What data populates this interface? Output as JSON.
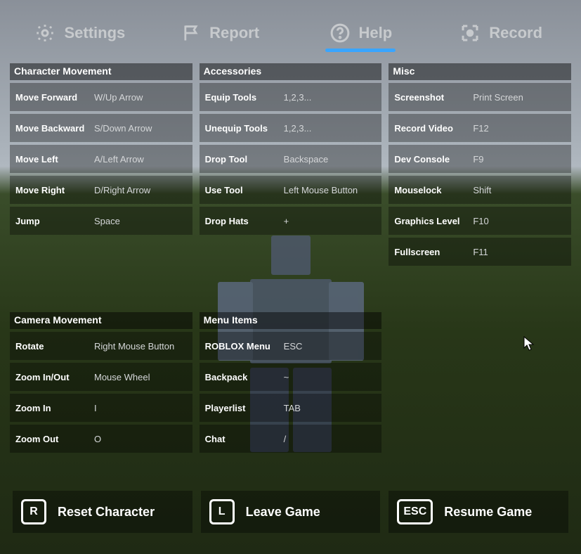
{
  "tabs": {
    "settings": "Settings",
    "report": "Report",
    "help": "Help",
    "record": "Record"
  },
  "sections": {
    "characterMovement": {
      "title": "Character Movement",
      "rows": [
        {
          "label": "Move Forward",
          "value": "W/Up Arrow"
        },
        {
          "label": "Move Backward",
          "value": "S/Down Arrow"
        },
        {
          "label": "Move Left",
          "value": "A/Left Arrow"
        },
        {
          "label": "Move Right",
          "value": "D/Right Arrow"
        },
        {
          "label": "Jump",
          "value": "Space"
        }
      ]
    },
    "accessories": {
      "title": "Accessories",
      "rows": [
        {
          "label": "Equip Tools",
          "value": "1,2,3..."
        },
        {
          "label": "Unequip Tools",
          "value": "1,2,3..."
        },
        {
          "label": "Drop Tool",
          "value": "Backspace"
        },
        {
          "label": "Use Tool",
          "value": "Left Mouse Button"
        },
        {
          "label": "Drop Hats",
          "value": "+"
        }
      ]
    },
    "misc": {
      "title": "Misc",
      "rows": [
        {
          "label": "Screenshot",
          "value": "Print Screen"
        },
        {
          "label": "Record Video",
          "value": "F12"
        },
        {
          "label": "Dev Console",
          "value": "F9"
        },
        {
          "label": "Mouselock",
          "value": "Shift"
        },
        {
          "label": "Graphics Level",
          "value": "F10"
        },
        {
          "label": "Fullscreen",
          "value": "F11"
        }
      ]
    },
    "cameraMovement": {
      "title": "Camera Movement",
      "rows": [
        {
          "label": "Rotate",
          "value": "Right Mouse Button"
        },
        {
          "label": "Zoom In/Out",
          "value": "Mouse Wheel"
        },
        {
          "label": "Zoom In",
          "value": "I"
        },
        {
          "label": "Zoom Out",
          "value": "O"
        }
      ]
    },
    "menuItems": {
      "title": "Menu Items",
      "rows": [
        {
          "label": "ROBLOX Menu",
          "value": "ESC"
        },
        {
          "label": "Backpack",
          "value": "~"
        },
        {
          "label": "Playerlist",
          "value": "TAB"
        },
        {
          "label": "Chat",
          "value": "/"
        }
      ]
    }
  },
  "footer": {
    "reset": {
      "key": "R",
      "label": "Reset Character"
    },
    "leave": {
      "key": "L",
      "label": "Leave Game"
    },
    "resume": {
      "key": "ESC",
      "label": "Resume Game"
    }
  }
}
